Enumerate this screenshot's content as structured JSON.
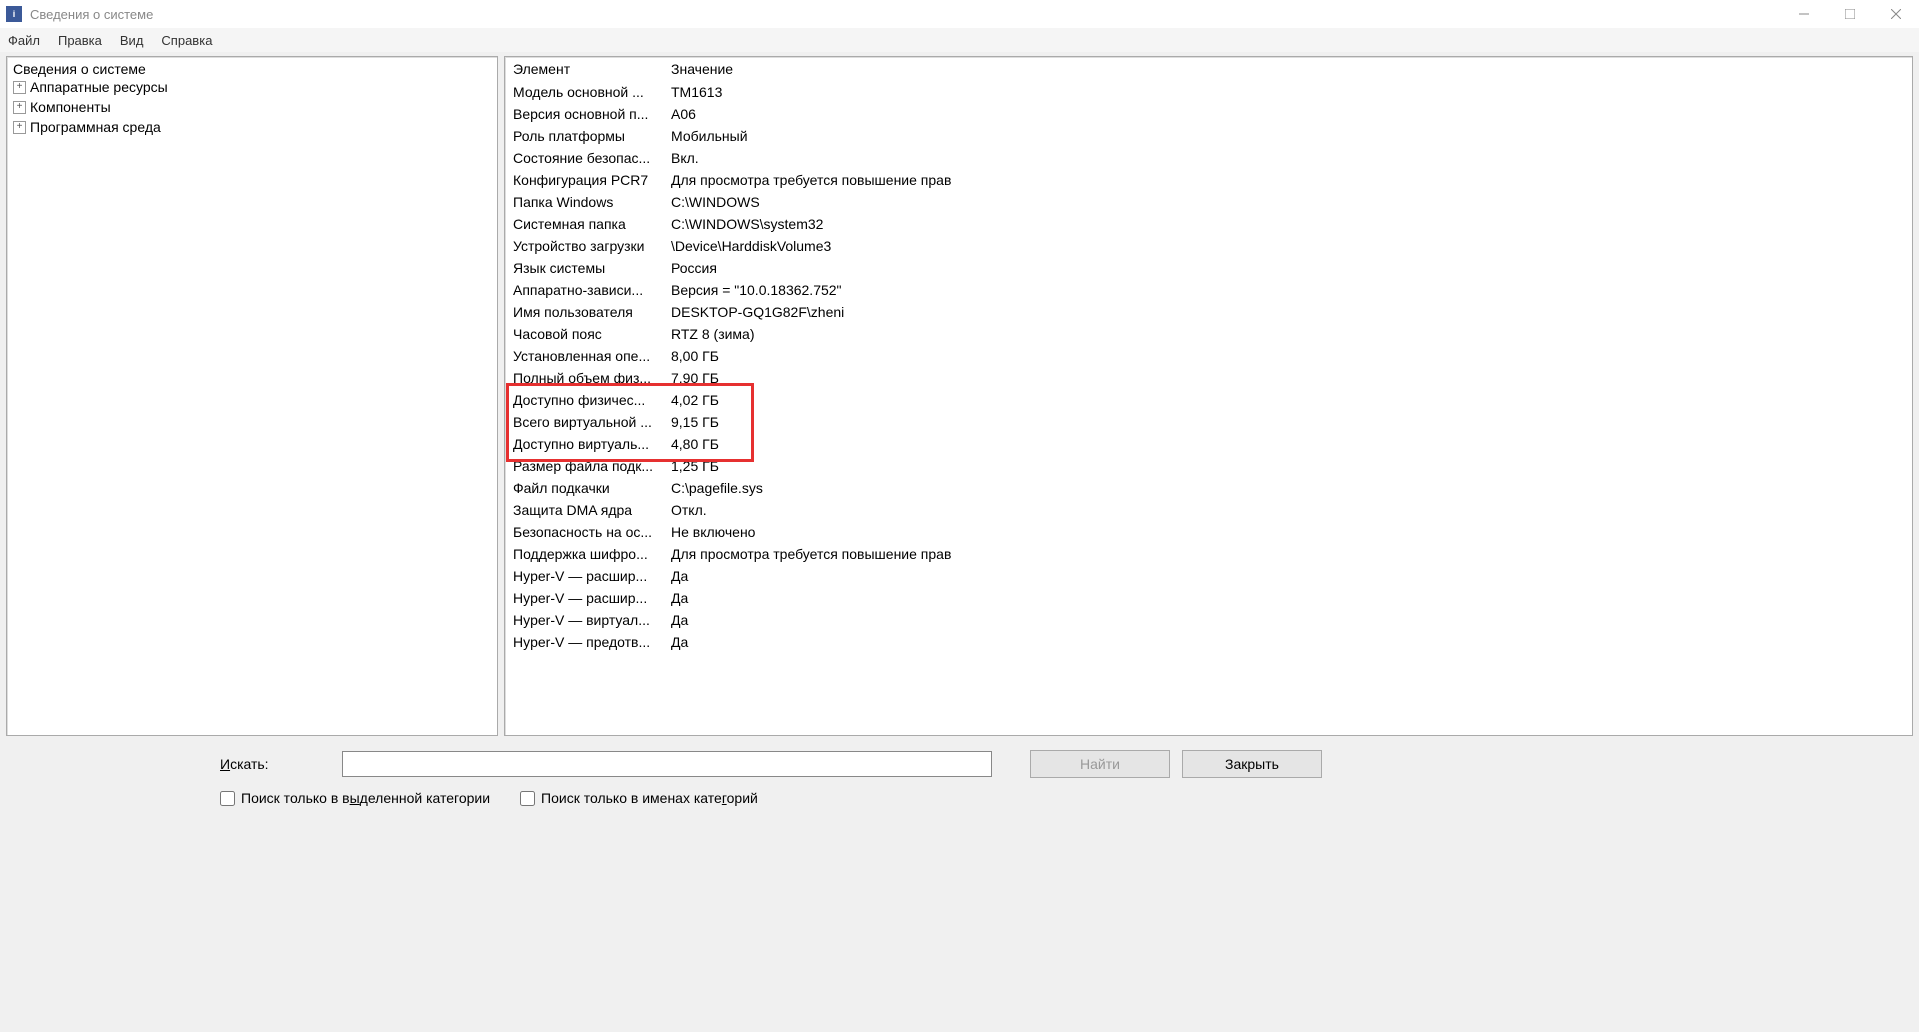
{
  "window": {
    "title": "Сведения о системе",
    "app_icon_text": "i"
  },
  "menu": {
    "file": "Файл",
    "edit": "Правка",
    "view": "Вид",
    "help": "Справка"
  },
  "tree": {
    "root": "Сведения о системе",
    "items": [
      "Аппаратные ресурсы",
      "Компоненты",
      "Программная среда"
    ]
  },
  "table": {
    "col_element": "Элемент",
    "col_value": "Значение",
    "rows": [
      {
        "k": "Модель основной ...",
        "v": "TM1613"
      },
      {
        "k": "Версия основной п...",
        "v": "A06"
      },
      {
        "k": "Роль платформы",
        "v": "Мобильный"
      },
      {
        "k": "Состояние безопас...",
        "v": "Вкл."
      },
      {
        "k": "Конфигурация PCR7",
        "v": "Для просмотра требуется повышение прав"
      },
      {
        "k": "Папка Windows",
        "v": "C:\\WINDOWS"
      },
      {
        "k": "Системная папка",
        "v": "C:\\WINDOWS\\system32"
      },
      {
        "k": "Устройство загрузки",
        "v": "\\Device\\HarddiskVolume3"
      },
      {
        "k": "Язык системы",
        "v": "Россия"
      },
      {
        "k": "Аппаратно-зависи...",
        "v": "Версия = \"10.0.18362.752\""
      },
      {
        "k": "Имя пользователя",
        "v": "DESKTOP-GQ1G82F\\zheni"
      },
      {
        "k": "Часовой пояс",
        "v": "RTZ 8 (зима)"
      },
      {
        "k": "Установленная опе...",
        "v": "8,00 ГБ"
      },
      {
        "k": "Полный объем физ...",
        "v": "7,90 ГБ"
      },
      {
        "k": "Доступно физичес...",
        "v": "4,02 ГБ"
      },
      {
        "k": "Всего виртуальной ...",
        "v": "9,15 ГБ"
      },
      {
        "k": "Доступно виртуаль...",
        "v": "4,80 ГБ"
      },
      {
        "k": "Размер файла подк...",
        "v": "1,25 ГБ"
      },
      {
        "k": "Файл подкачки",
        "v": "C:\\pagefile.sys"
      },
      {
        "k": "Защита DMA ядра",
        "v": "Откл."
      },
      {
        "k": "Безопасность на ос...",
        "v": "Не включено"
      },
      {
        "k": "Поддержка шифро...",
        "v": "Для просмотра требуется повышение прав"
      },
      {
        "k": "Hyper-V — расшир...",
        "v": "Да"
      },
      {
        "k": "Hyper-V — расшир...",
        "v": "Да"
      },
      {
        "k": "Hyper-V — виртуал...",
        "v": "Да"
      },
      {
        "k": "Hyper-V — предотв...",
        "v": "Да"
      }
    ]
  },
  "search": {
    "label_prefix": "И",
    "label_rest": "скать:",
    "placeholder": "",
    "find_btn": "Найти",
    "close_btn": "Закрыть"
  },
  "checks": {
    "c1_a": "Поиск только в в",
    "c1_u": "ы",
    "c1_b": "деленной категории",
    "c2_a": "Поиск только в именах кате",
    "c2_u": "г",
    "c2_b": "орий"
  }
}
